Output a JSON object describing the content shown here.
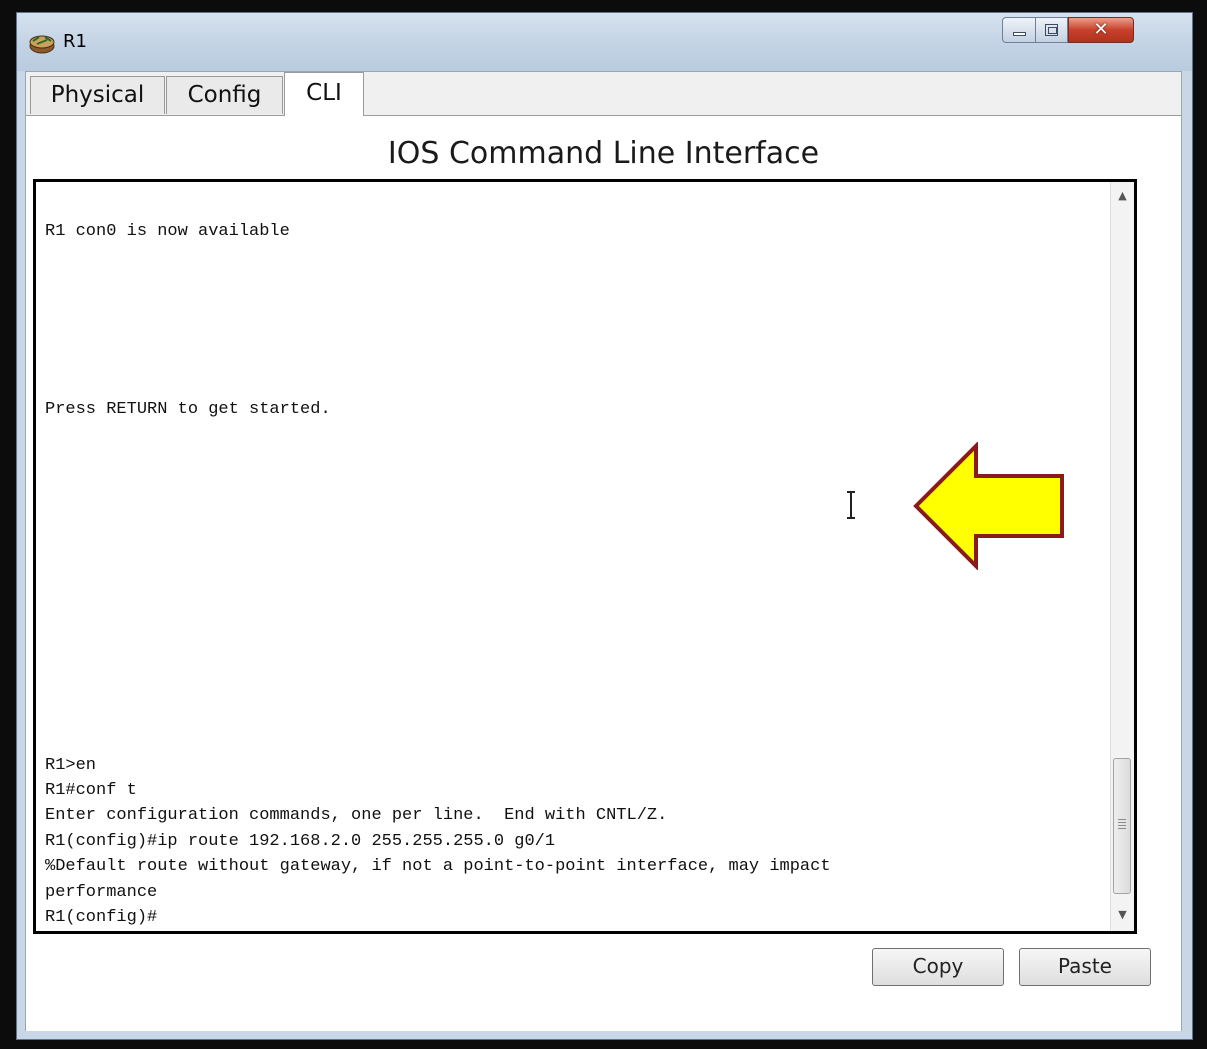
{
  "window": {
    "title": "R1"
  },
  "tabs": [
    {
      "label": "Physical",
      "active": false
    },
    {
      "label": "Config",
      "active": false
    },
    {
      "label": "CLI",
      "active": true
    }
  ],
  "cli": {
    "heading": "IOS Command Line Interface",
    "lines": [
      "R1 con0 is now available",
      "Press RETURN to get started.",
      "R1>en",
      "R1#conf t",
      "Enter configuration commands, one per line.  End with CNTL/Z.",
      "R1(config)#ip route 192.168.2.0 255.255.255.0 g0/1",
      "%Default route without gateway, if not a point-to-point interface, may impact",
      "performance",
      "R1(config)#"
    ]
  },
  "buttons": {
    "copy": "Copy",
    "paste": "Paste"
  },
  "annotation": {
    "type": "arrow",
    "direction": "left",
    "fill": "#ffff00",
    "stroke": "#8b1a1a"
  },
  "colors": {
    "close_button": "#c8412b",
    "window_frame": "#c8d6e6"
  }
}
